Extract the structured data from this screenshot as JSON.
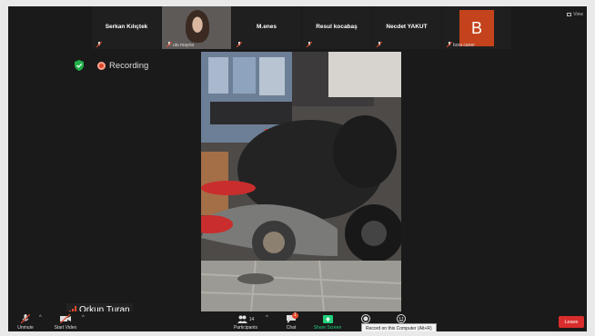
{
  "strip": {
    "tiles": [
      {
        "name": "Serkan Kılıçtek",
        "label": ""
      },
      {
        "name": "",
        "label": "ulu mayna"
      },
      {
        "name": "M.enes",
        "label": ""
      },
      {
        "name": "Resul kocabaş",
        "label": ""
      },
      {
        "name": "Necdet YAKUT",
        "label": ""
      },
      {
        "name": "",
        "label": "bora caner",
        "avatar_letter": "B"
      }
    ],
    "view_label": "View"
  },
  "recording": {
    "label": "Recording"
  },
  "speaker": {
    "name": "Orkun Turan"
  },
  "toolbar": {
    "unmute": "Unmute",
    "start_video": "Start Video",
    "participants": "Participants",
    "participants_count": "14",
    "chat": "Chat",
    "chat_badge": "1",
    "share_screen": "Share Screen",
    "record_tooltip": "Record on this Computer (Alt+R)",
    "leave": "Leave"
  },
  "colors": {
    "background": "#1a1a1a",
    "accent_blue": "#2d8cff",
    "share_green": "#21d07a",
    "leave_red": "#d92d2d",
    "avatar_orange": "#c4431c",
    "recording_red": "#e0492c"
  },
  "icons": [
    "muted-mic-icon",
    "shield-check-icon",
    "record-dot-icon",
    "video-off-icon",
    "participants-icon",
    "chat-icon",
    "share-screen-icon",
    "record-icon",
    "reactions-icon",
    "chevron-right-icon",
    "view-icon"
  ]
}
